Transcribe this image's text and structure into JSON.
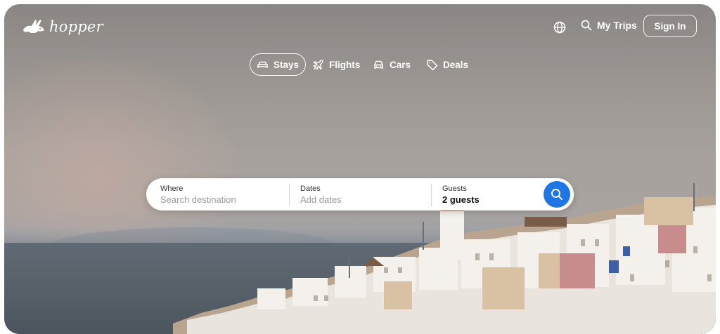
{
  "brand": {
    "name": "hopper",
    "logo_icon": "bunny-logo-icon"
  },
  "header": {
    "language_icon": "globe-icon",
    "my_trips_label": "My Trips",
    "sign_in_label": "Sign In"
  },
  "tabs": [
    {
      "label": "Stays",
      "icon": "bed-icon",
      "active": true
    },
    {
      "label": "Flights",
      "icon": "airplane-icon",
      "active": false
    },
    {
      "label": "Cars",
      "icon": "car-icon",
      "active": false
    },
    {
      "label": "Deals",
      "icon": "tag-icon",
      "active": false
    }
  ],
  "search": {
    "where": {
      "label": "Where",
      "placeholder": "Search destination"
    },
    "dates": {
      "label": "Dates",
      "placeholder": "Add dates"
    },
    "guests": {
      "label": "Guests",
      "value": "2 guests"
    },
    "button_icon": "search-icon"
  },
  "colors": {
    "accent": "#1f75e6",
    "text_on_hero": "#ffffff"
  }
}
